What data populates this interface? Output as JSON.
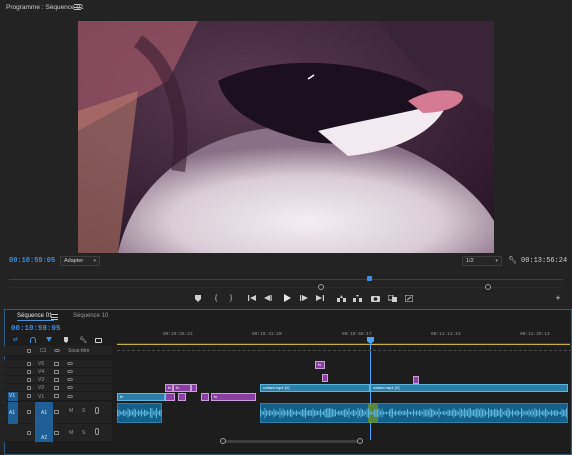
{
  "program_monitor": {
    "title": "Programme : Séquence 01",
    "current_timecode": "00:10:59:05",
    "zoom_label": "Adapter",
    "resolution_label": "1/2",
    "duration_timecode": "00:13:56:24"
  },
  "controls": {
    "icons": [
      "marker-icon",
      "mark-in-icon",
      "mark-out-icon",
      "go-to-in-icon",
      "step-back-icon",
      "play-icon",
      "step-forward-icon",
      "go-to-out-icon",
      "lift-icon",
      "extract-icon",
      "export-frame-icon",
      "comparison-view-icon",
      "toggle-proxies-icon",
      "add-button-icon"
    ]
  },
  "timeline": {
    "tabs": [
      "Séquence 01",
      "Séquence 10"
    ],
    "timecode": "00:10:59:05",
    "ruler_labels": [
      "00:10:26:22",
      "00:10:41:20",
      "00:10:56:17",
      "00:11:11:15",
      "00:11:26:13"
    ],
    "caption_track_label": "Sous-titre",
    "video_tracks": [
      "V5",
      "V4",
      "V3",
      "V2",
      "V1"
    ],
    "audio_tracks": [
      "A1",
      "A2"
    ],
    "track_flag_labels": [
      "C1",
      "V1",
      "A1"
    ],
    "clip_labels": {
      "fx": "fx",
      "v1_clip_a": "collant.mp4 [V]",
      "v1_clip_b": "collant.mp4 [V]",
      "mute": "M",
      "solo": "S"
    }
  },
  "colors": {
    "accent_blue": "#3b8fe0",
    "video_clip_purple": "#8b3fa4",
    "video_clip_blue": "#2b7fa8",
    "audio_waveform": "#5ab6dc"
  }
}
